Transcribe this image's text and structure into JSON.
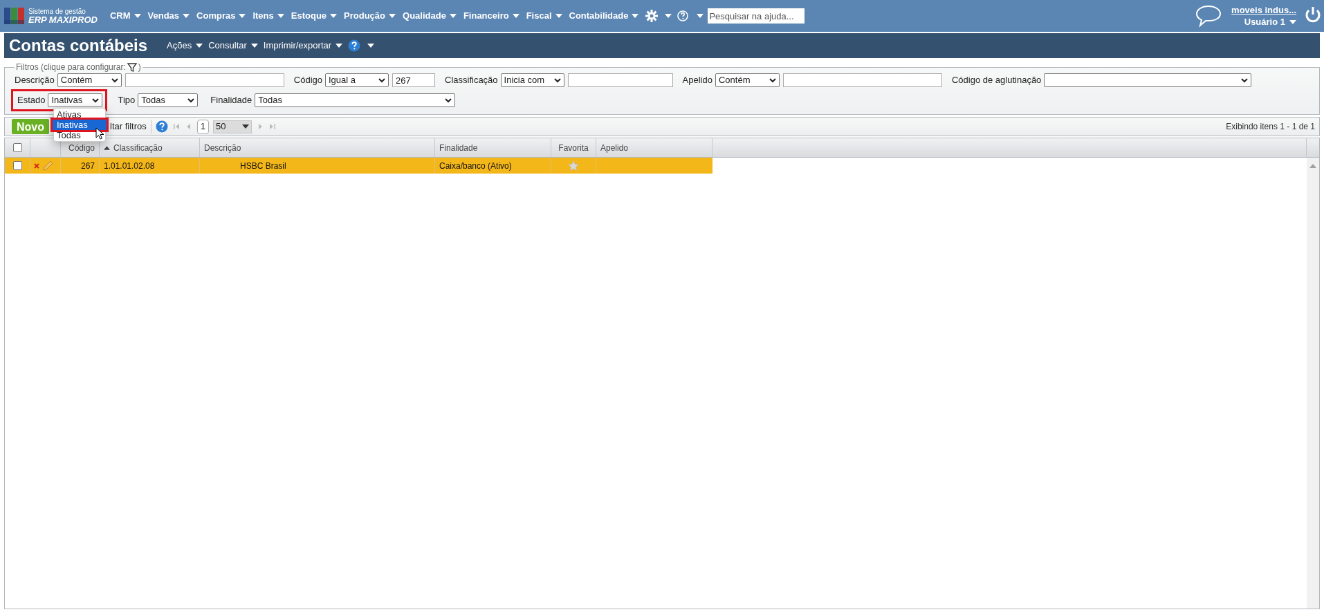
{
  "logo": {
    "line1": "Sistema de gestão",
    "line2": "ERP MAXIPROD"
  },
  "menu": [
    {
      "label": "CRM"
    },
    {
      "label": "Vendas"
    },
    {
      "label": "Compras"
    },
    {
      "label": "Itens"
    },
    {
      "label": "Estoque"
    },
    {
      "label": "Produção"
    },
    {
      "label": "Qualidade"
    },
    {
      "label": "Financeiro"
    },
    {
      "label": "Fiscal"
    },
    {
      "label": "Contabilidade"
    }
  ],
  "help_search": {
    "placeholder": "Pesquisar na ajuda..."
  },
  "user": {
    "company": "moveis indus...",
    "name": "Usuário 1"
  },
  "page": {
    "title": "Contas contábeis",
    "actions": [
      "Ações",
      "Consultar",
      "Imprimir/exportar"
    ]
  },
  "filters": {
    "legend": "Filtros (clique para configurar:",
    "legend_end": ")",
    "row_1": [
      {
        "kind": "select_text",
        "label": "Descrição",
        "operator": "Contém"
      },
      {
        "kind": "select_text",
        "label": "Código",
        "operator": "Igual a",
        "value": "267"
      },
      {
        "kind": "select_text",
        "label": "Classificação",
        "operator": "Inicia com"
      },
      {
        "kind": "select_text",
        "label": "Apelido",
        "operator": "Contém"
      },
      {
        "kind": "select",
        "label": "Código de aglutinação"
      }
    ],
    "row_2": [
      {
        "label": "Estado",
        "value": "Inativas",
        "highlighted": true,
        "options": [
          {
            "label": "Ativas",
            "selected": false
          },
          {
            "label": "Inativas",
            "selected": true
          },
          {
            "label": "Todas",
            "selected": false
          }
        ]
      },
      {
        "label": "Tipo",
        "value": "Todas",
        "highlighted": false
      },
      {
        "label": "Finalidade",
        "value": "Todas",
        "highlighted": false
      }
    ]
  },
  "toolbar": {
    "new_button": "Novo",
    "filters_button": "ltar filtros",
    "page": "1",
    "page_size": "50",
    "summary": "Exibindo itens 1 - 1 de 1"
  },
  "table": {
    "all_checked": false,
    "columns": [
      {
        "label": "Código",
        "sorted": false
      },
      {
        "label": "Classificação",
        "sorted": true
      },
      {
        "label": "Descrição",
        "sorted": false
      },
      {
        "label": "Finalidade",
        "sorted": false
      },
      {
        "label": "Favorita",
        "sorted": false
      },
      {
        "label": "Apelido",
        "sorted": false
      }
    ],
    "rows": [
      {
        "selected": true,
        "checked": false,
        "codigo": "267",
        "classificacao": "1.01.01.02.08",
        "descricao": "HSBC Brasil",
        "finalidade": "Caixa/banco (Ativo)",
        "favorite": false
      }
    ]
  }
}
